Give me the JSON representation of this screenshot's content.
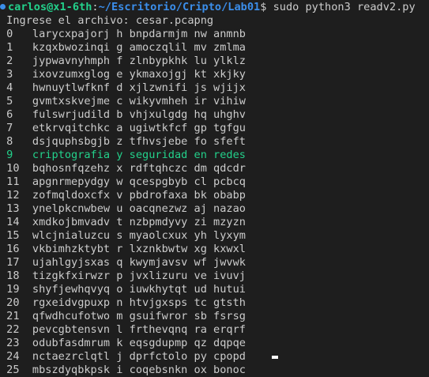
{
  "prompt": {
    "user_host": "carlos@x1-6th",
    "separator": ":",
    "path": "~/Escritorio/Cripto/Lab01",
    "symbol": "$",
    "command": " sudo python3 readv2.py"
  },
  "output": {
    "input_prompt": " Ingrese el archivo: cesar.pcapng",
    "highlight_index": 9,
    "rows": [
      {
        "num": "0",
        "text": " larycxpajorj h bnpdarmjm nw anmnb"
      },
      {
        "num": "1",
        "text": " kzqxbwozinqi g amoczqlil mv zmlma"
      },
      {
        "num": "2",
        "text": " jypwavnyhmph f zlnbypkhk lu ylklz"
      },
      {
        "num": "3",
        "text": " ixovzumxglog e ykmaxojgj kt xkjky"
      },
      {
        "num": "4",
        "text": " hwnuytlwfknf d xjlzwnifi js wjijx"
      },
      {
        "num": "5",
        "text": " gvmtxskvejme c wikyvmheh ir vihiw"
      },
      {
        "num": "6",
        "text": " fulswrjudild b vhjxulgdg hq uhghv"
      },
      {
        "num": "7",
        "text": " etkrvqitchkc a ugiwtkfcf gp tgfgu"
      },
      {
        "num": "8",
        "text": " dsjquphsbgjb z tfhvsjebe fo sfeft"
      },
      {
        "num": "9",
        "text": " criptografia y seguridad en redes"
      },
      {
        "num": "10",
        "text": " bqhosnfqzehz x rdftqhczc dm qdcdr"
      },
      {
        "num": "11",
        "text": " apgnrmepydgy w qcespgbyb cl pcbcq"
      },
      {
        "num": "12",
        "text": " zofmqldoxcfx v pbdrofaxa bk obabp"
      },
      {
        "num": "13",
        "text": " ynelpkcnwbew u oacqnezwz aj nazao"
      },
      {
        "num": "14",
        "text": " xmdkojbmvadv t nzbpmdyvy zi mzyzn"
      },
      {
        "num": "15",
        "text": " wlcjnialuzcu s myaolcxux yh lyxym"
      },
      {
        "num": "16",
        "text": " vkbimhzktybt r lxznkbwtw xg kxwxl"
      },
      {
        "num": "17",
        "text": " ujahlgyjsxas q kwymjavsv wf jwvwk"
      },
      {
        "num": "18",
        "text": " tizgkfxirwzr p jvxlizuru ve ivuvj"
      },
      {
        "num": "19",
        "text": " shyfjewhqvyq o iuwkhytqt ud hutui"
      },
      {
        "num": "20",
        "text": " rgxeidvgpuxp n htvjgxsps tc gtsth"
      },
      {
        "num": "21",
        "text": " qfwdhcufotwo m gsuifwror sb fsrsg"
      },
      {
        "num": "22",
        "text": " pevcgbtensvn l frthevqnq ra erqrf"
      },
      {
        "num": "23",
        "text": " odubfasdmrum k eqsgdupmp qz dqpqe"
      },
      {
        "num": "24",
        "text": " nctaezrclqtl j dprfctolo py cpopd"
      },
      {
        "num": "25",
        "text": " mbszdyqbkpsk i coqebsnkn ox bonoc"
      }
    ]
  },
  "colors": {
    "background": "#1e1e1e",
    "text": "#cccccc",
    "user_host": "#23d18b",
    "path": "#3b8eea",
    "highlight": "#23d18b"
  }
}
